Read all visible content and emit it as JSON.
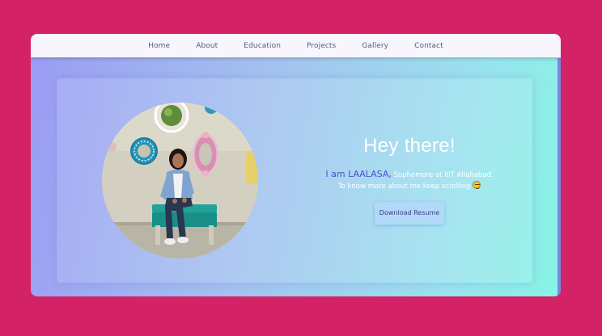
{
  "nav": {
    "items": [
      "Home",
      "About",
      "Education",
      "Projects",
      "Gallery",
      "Contact"
    ]
  },
  "hero": {
    "greeting": "Hey there!",
    "intro_lead": "I am LAALASA,",
    "intro_rest": " Sophomore at IIIT Allahabad.",
    "intro_line2": "To know more about me keep scrolling",
    "emoji_icon": "grinning-face-emoji",
    "resume_button": "Download Resume"
  },
  "colors": {
    "page_background": "#d42267",
    "accent_name": "#4b4fc7",
    "navbar": "#f6f6fc"
  }
}
